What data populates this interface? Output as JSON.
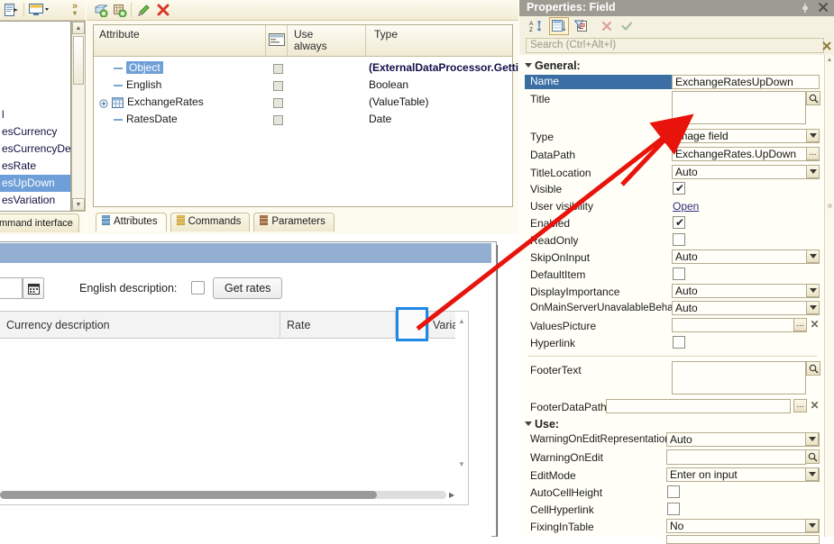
{
  "left_panel": {
    "toolbar": [
      {
        "name": "open-module-icon",
        "glyph": "▤"
      },
      {
        "name": "display-monitor-icon",
        "glyph": "▭"
      },
      {
        "name": "overflow-chevrons-icon",
        "glyph": "»"
      }
    ],
    "list_items": [
      {
        "label": "l",
        "selected": false
      },
      {
        "label": "esCurrency",
        "selected": false
      },
      {
        "label": "esCurrencyDe_",
        "selected": false
      },
      {
        "label": "esRate",
        "selected": false
      },
      {
        "label": "esUpDown",
        "selected": true
      },
      {
        "label": "esVariation",
        "selected": false
      }
    ],
    "tab_label": "mmand interface"
  },
  "attributes_panel": {
    "toolbar": [
      {
        "name": "add-attribute-icon",
        "glyph": "+"
      },
      {
        "name": "add-table-icon",
        "glyph": "+"
      },
      {
        "name": "edit-icon",
        "glyph": "✎"
      },
      {
        "name": "delete-icon",
        "glyph": "✖"
      }
    ],
    "columns": [
      "Attribute",
      "Use\nalways",
      "Type"
    ],
    "column_attribute": "Attribute",
    "column_use_always_line1": "Use",
    "column_use_always_line2": "always",
    "column_type": "Type",
    "rows": [
      {
        "name": "Object",
        "selected": true,
        "kind": "field",
        "use_always": false,
        "type": "(ExternalDataProcessor.Gettin_",
        "bold": true
      },
      {
        "name": "English",
        "selected": false,
        "kind": "field",
        "use_always": false,
        "type": "Boolean",
        "bold": false
      },
      {
        "name": "ExchangeRates",
        "selected": false,
        "kind": "table",
        "use_always": false,
        "type": "(ValueTable)",
        "bold": false
      },
      {
        "name": "RatesDate",
        "selected": false,
        "kind": "field",
        "use_always": false,
        "type": "Date",
        "bold": false
      }
    ],
    "tabs": [
      {
        "label": "Attributes",
        "active": true,
        "icon": "stack-blue-icon"
      },
      {
        "label": "Commands",
        "active": false,
        "icon": "stack-yellow-icon"
      },
      {
        "label": "Parameters",
        "active": false,
        "icon": "stack-brown-icon"
      }
    ]
  },
  "form_preview": {
    "date_field_value": "",
    "calendar_icon": "calendar-icon",
    "english_description_label": "English description:",
    "english_description_checked": false,
    "get_rates_button": "Get rates",
    "table_headers": [
      {
        "label": "Currency description"
      },
      {
        "label": "Rate"
      },
      {
        "label": ""
      },
      {
        "label": "Variat"
      }
    ],
    "selected_cell_name": "up-down-image-column-cell"
  },
  "properties": {
    "title": "Properties: Field",
    "pin_icon": "pin-icon",
    "close_icon": "close-icon",
    "toolbar": [
      {
        "name": "sort-alphabetical-icon",
        "glyph": "A\nZ",
        "active": false
      },
      {
        "name": "group-by-category-icon",
        "glyph": "▤",
        "active": true
      },
      {
        "name": "filter-icon",
        "glyph": "▼",
        "active": false
      },
      {
        "name": "clear-icon",
        "glyph": "✕",
        "active": false
      },
      {
        "name": "apply-icon",
        "glyph": "✓",
        "active": false
      }
    ],
    "search_placeholder": "Search (Ctrl+Alt+I)",
    "search_value": "",
    "search_clear_icon": "clear-search-icon",
    "groups": [
      {
        "title": "General:",
        "rows": [
          {
            "label": "Name",
            "type": "text-selected",
            "value": "ExchangeRatesUpDown"
          },
          {
            "label": "Title",
            "type": "multiline-search",
            "value": ""
          },
          {
            "label": "Type",
            "type": "dropdown",
            "value": "Image field"
          },
          {
            "label": "DataPath",
            "type": "text-dots",
            "value": "ExchangeRates.UpDown"
          },
          {
            "label": "TitleLocation",
            "type": "dropdown",
            "value": "Auto"
          },
          {
            "label": "Visible",
            "type": "checkbox",
            "checked": true
          },
          {
            "label": "User visibility",
            "type": "link",
            "value": "Open"
          },
          {
            "label": "Enabled",
            "type": "checkbox",
            "checked": true
          },
          {
            "label": "ReadOnly",
            "type": "checkbox",
            "checked": false
          },
          {
            "label": "SkipOnInput",
            "type": "dropdown",
            "value": "Auto"
          },
          {
            "label": "DefaultItem",
            "type": "checkbox",
            "checked": false
          },
          {
            "label": "DisplayImportance",
            "type": "dropdown",
            "value": "Auto"
          },
          {
            "label": "OnMainServerUnavalableBehav",
            "type": "dropdown",
            "value": "Auto"
          },
          {
            "label": "ValuesPicture",
            "type": "text-dots-x",
            "value": ""
          },
          {
            "label": "Hyperlink",
            "type": "checkbox",
            "checked": false
          },
          {
            "label": "FooterText",
            "type": "multiline-search",
            "value": ""
          },
          {
            "label": "FooterDataPath",
            "type": "text-dots-x",
            "value": ""
          }
        ]
      },
      {
        "title": "Use:",
        "rows": [
          {
            "label": "WarningOnEditRepresentation",
            "type": "dropdown",
            "value": "Auto"
          },
          {
            "label": "WarningOnEdit",
            "type": "text-search",
            "value": ""
          },
          {
            "label": "EditMode",
            "type": "dropdown",
            "value": "Enter on input"
          },
          {
            "label": "AutoCellHeight",
            "type": "checkbox",
            "checked": false
          },
          {
            "label": "CellHyperlink",
            "type": "checkbox",
            "checked": false
          },
          {
            "label": "FixingInTable",
            "type": "dropdown",
            "value": "No"
          }
        ]
      }
    ]
  },
  "annotation": {
    "arrow_color": "#e8140c",
    "description": "red-arrow-pointing-to-type-field"
  },
  "colors": {
    "selection_blue": "#3a6ea5",
    "panel_cream": "#f5f1e0",
    "title_gray": "#9e9b92",
    "form_title_blue": "#92aed1",
    "cell_highlight": "#1e88e5"
  }
}
